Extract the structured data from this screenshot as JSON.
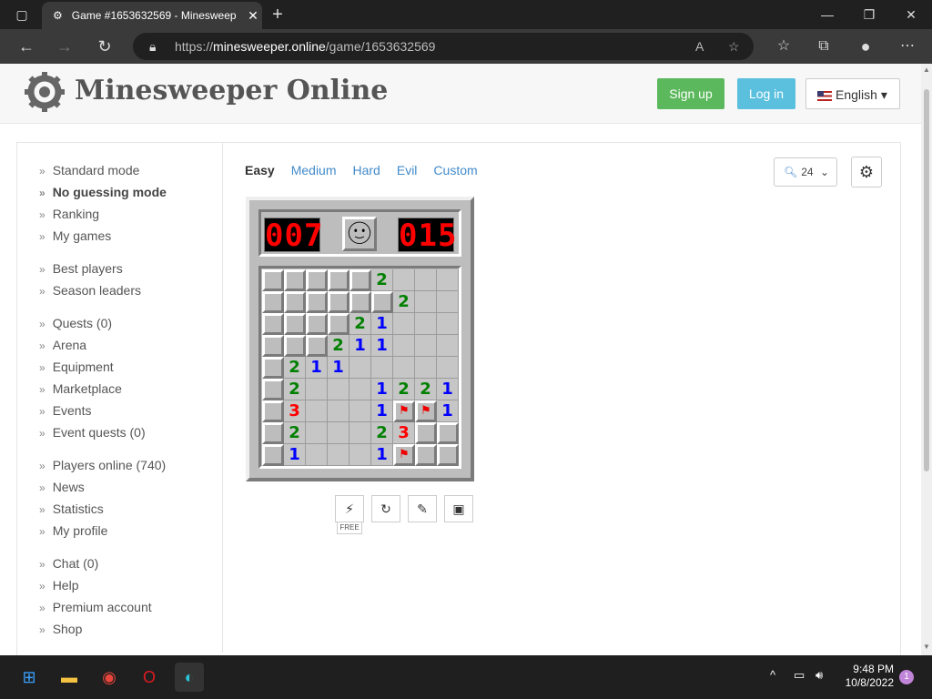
{
  "browser": {
    "tab_title": "Game #1653632569 - Minesweep",
    "url_prefix": "https://",
    "url_host": "minesweeper.online",
    "url_path": "/game/1653632569"
  },
  "header": {
    "logo_text": "Minesweeper Online",
    "signup_label": "Sign up",
    "login_label": "Log in",
    "language_label": "English"
  },
  "sidebar": {
    "groups": [
      [
        "Standard mode",
        "No guessing mode",
        "Ranking",
        "My games"
      ],
      [
        "Best players",
        "Season leaders"
      ],
      [
        "Quests (0)",
        "Arena",
        "Equipment",
        "Marketplace",
        "Events",
        "Event quests (0)"
      ],
      [
        "Players online (740)",
        "News",
        "Statistics",
        "My profile"
      ],
      [
        "Chat (0)",
        "Help",
        "Premium account",
        "Shop"
      ]
    ],
    "active": "No guessing mode"
  },
  "modes": [
    "Easy",
    "Medium",
    "Hard",
    "Evil",
    "Custom"
  ],
  "current_mode": "Easy",
  "zoom_value": "24",
  "game": {
    "mines_counter": "007",
    "timer": "015",
    "face": "smile",
    "rows": [
      "#####2..",
      "######2..",
      "####21..",
      "###211...",
      "#211.....",
      "#2...1221",
      "#3...1FF1",
      "#2...23##",
      "#1...1F##"
    ]
  },
  "tools_free_label": "FREE",
  "taskbar": {
    "time": "9:48 PM",
    "date": "10/8/2022",
    "notifications": "1"
  },
  "colors": {
    "signup": "#5cb85c",
    "login": "#5bc0de",
    "link": "#428bca",
    "num1": "#0000ff",
    "num2": "#008000",
    "num3": "#ff0000"
  }
}
